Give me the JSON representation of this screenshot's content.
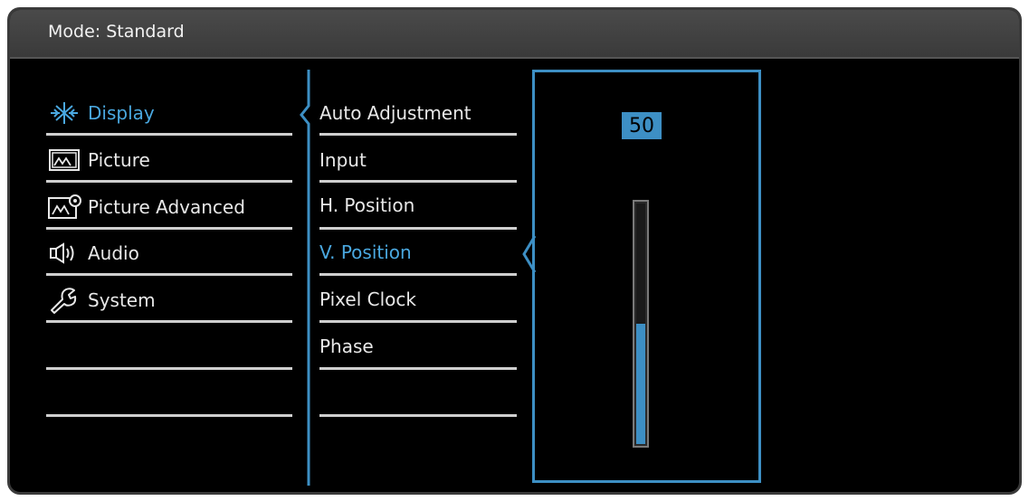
{
  "header": {
    "title": "Mode: Standard"
  },
  "main_menu": {
    "items": [
      {
        "label": "Display",
        "icon": "display-brightness-icon",
        "active": true
      },
      {
        "label": "Picture",
        "icon": "picture-icon",
        "active": false
      },
      {
        "label": "Picture Advanced",
        "icon": "picture-advanced-icon",
        "active": false
      },
      {
        "label": "Audio",
        "icon": "speaker-icon",
        "active": false
      },
      {
        "label": "System",
        "icon": "wrench-icon",
        "active": false
      }
    ]
  },
  "sub_menu": {
    "items": [
      {
        "label": "Auto Adjustment",
        "active": false
      },
      {
        "label": "Input",
        "active": false
      },
      {
        "label": "H. Position",
        "active": false
      },
      {
        "label": "V. Position",
        "active": true
      },
      {
        "label": "Pixel Clock",
        "active": false
      },
      {
        "label": "Phase",
        "active": false
      }
    ]
  },
  "value_panel": {
    "value": "50",
    "slider_fraction": 0.5
  },
  "colors": {
    "accent": "#3d8fc4",
    "text": "#e8e8e8",
    "background": "#000000"
  }
}
